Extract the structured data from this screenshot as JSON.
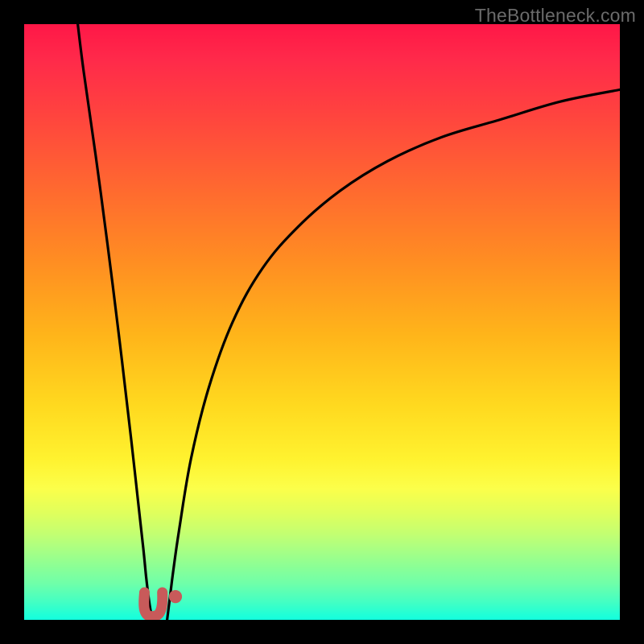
{
  "watermark": "TheBottleneck.com",
  "colors": {
    "frame": "#000000",
    "curve": "#000000",
    "marker": "#c85a5a"
  },
  "chart_data": {
    "type": "line",
    "title": "",
    "xlabel": "",
    "ylabel": "",
    "xlim": [
      0,
      100
    ],
    "ylim": [
      0,
      100
    ],
    "series": [
      {
        "name": "left-curve",
        "x": [
          9,
          10,
          12,
          14,
          16,
          18,
          19,
          20,
          20.5,
          21,
          21.5
        ],
        "y": [
          100,
          92,
          78,
          63,
          47,
          30,
          21,
          12,
          7,
          3,
          0
        ]
      },
      {
        "name": "right-curve",
        "x": [
          24,
          24.5,
          25,
          26,
          28,
          31,
          35,
          40,
          46,
          53,
          61,
          70,
          80,
          90,
          100
        ],
        "y": [
          0,
          4,
          8,
          15,
          27,
          39,
          50,
          59,
          66,
          72,
          77,
          81,
          84,
          87,
          89
        ]
      },
      {
        "name": "u-marker",
        "x": [
          20.2,
          20.1,
          20.2,
          20.7,
          21.6,
          22.5,
          23.0,
          23.2,
          23.2
        ],
        "y": [
          4.6,
          3.0,
          1.7,
          0.8,
          0.6,
          0.9,
          1.8,
          3.1,
          4.6
        ]
      },
      {
        "name": "dots",
        "points": [
          {
            "x": 25.4,
            "y": 3.9,
            "r": 1.1
          }
        ]
      }
    ]
  }
}
